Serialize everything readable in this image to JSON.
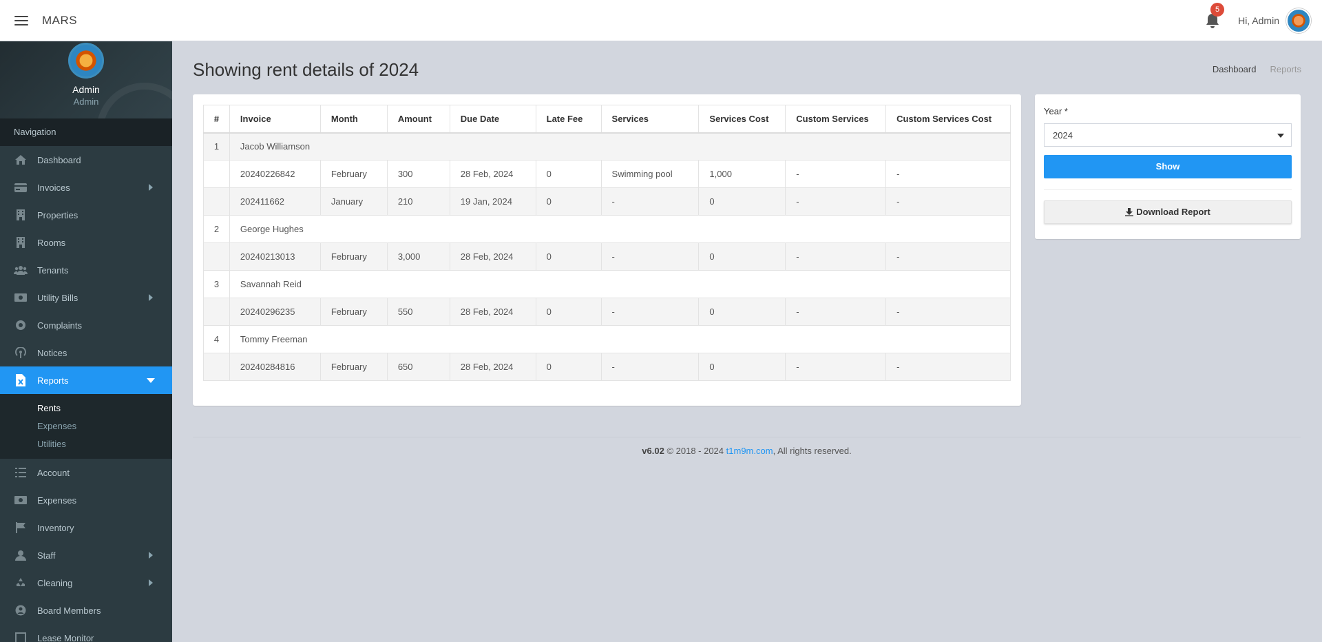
{
  "header": {
    "brand": "MARS",
    "notification_count": "5",
    "greeting": "Hi, Admin"
  },
  "sidebar": {
    "user_name": "Admin",
    "user_role": "Admin",
    "nav_header": "Navigation",
    "items": [
      {
        "label": "Dashboard",
        "icon": "dashboard-icon",
        "has_caret": false
      },
      {
        "label": "Invoices",
        "icon": "invoice-icon",
        "has_caret": true
      },
      {
        "label": "Properties",
        "icon": "building-icon",
        "has_caret": false
      },
      {
        "label": "Rooms",
        "icon": "building-icon",
        "has_caret": false
      },
      {
        "label": "Tenants",
        "icon": "users-icon",
        "has_caret": false
      },
      {
        "label": "Utility Bills",
        "icon": "money-icon",
        "has_caret": true
      },
      {
        "label": "Complaints",
        "icon": "lifebuoy-icon",
        "has_caret": false
      },
      {
        "label": "Notices",
        "icon": "broadcast-icon",
        "has_caret": false
      },
      {
        "label": "Reports",
        "icon": "excel-file-icon",
        "has_caret": true,
        "active": true
      },
      {
        "label": "Account",
        "icon": "list-icon",
        "has_caret": false
      },
      {
        "label": "Expenses",
        "icon": "money-icon",
        "has_caret": false
      },
      {
        "label": "Inventory",
        "icon": "flag-icon",
        "has_caret": false
      },
      {
        "label": "Staff",
        "icon": "user-icon",
        "has_caret": true
      },
      {
        "label": "Cleaning",
        "icon": "recycle-icon",
        "has_caret": true
      },
      {
        "label": "Board Members",
        "icon": "user-circle-icon",
        "has_caret": false
      },
      {
        "label": "Lease Monitor",
        "icon": "square-icon",
        "has_caret": false
      }
    ],
    "reports_sub": [
      "Rents",
      "Expenses",
      "Utilities"
    ]
  },
  "main": {
    "title": "Showing rent details of 2024",
    "breadcrumb": [
      "Dashboard",
      "Reports"
    ],
    "table": {
      "headers": [
        "#",
        "Invoice",
        "Month",
        "Amount",
        "Due Date",
        "Late Fee",
        "Services",
        "Services Cost",
        "Custom Services",
        "Custom Services Cost"
      ],
      "groups": [
        {
          "num": "1",
          "name": "Jacob Williamson",
          "rows": [
            [
              "20240226842",
              "February",
              "300",
              "28 Feb, 2024",
              "0",
              "Swimming pool",
              "1,000",
              "-",
              "-"
            ],
            [
              "202411662",
              "January",
              "210",
              "19 Jan, 2024",
              "0",
              "-",
              "0",
              "-",
              "-"
            ]
          ]
        },
        {
          "num": "2",
          "name": "George Hughes",
          "rows": [
            [
              "20240213013",
              "February",
              "3,000",
              "28 Feb, 2024",
              "0",
              "-",
              "0",
              "-",
              "-"
            ]
          ]
        },
        {
          "num": "3",
          "name": "Savannah Reid",
          "rows": [
            [
              "20240296235",
              "February",
              "550",
              "28 Feb, 2024",
              "0",
              "-",
              "0",
              "-",
              "-"
            ]
          ]
        },
        {
          "num": "4",
          "name": "Tommy Freeman",
          "rows": [
            [
              "20240284816",
              "February",
              "650",
              "28 Feb, 2024",
              "0",
              "-",
              "0",
              "-",
              "-"
            ]
          ]
        }
      ]
    }
  },
  "filter": {
    "year_label": "Year *",
    "year_value": "2024",
    "show_label": "Show",
    "download_label": "Download Report"
  },
  "footer": {
    "version": "v6.02",
    "copyright": "© 2018 - 2024",
    "link": "t1m9m.com",
    "rights": ", All rights reserved."
  },
  "colors": {
    "accent": "#2196f3",
    "sidebar_bg": "#2c3b41",
    "badge": "#dd4b39"
  }
}
